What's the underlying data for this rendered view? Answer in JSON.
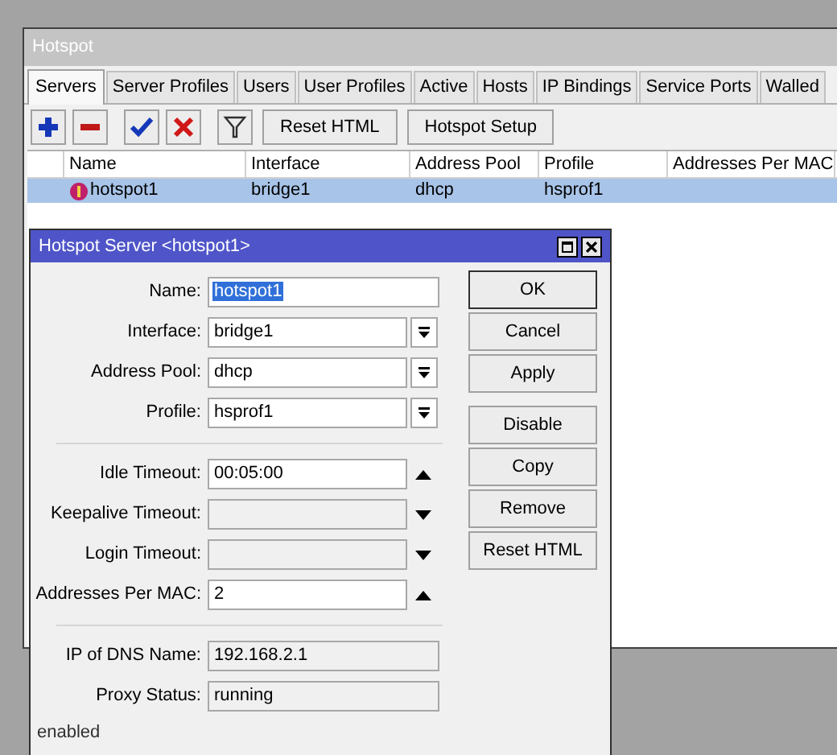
{
  "window": {
    "title": "Hotspot"
  },
  "tabs": [
    {
      "label": "Servers",
      "selected": true
    },
    {
      "label": "Server Profiles",
      "selected": false
    },
    {
      "label": "Users",
      "selected": false
    },
    {
      "label": "User Profiles",
      "selected": false
    },
    {
      "label": "Active",
      "selected": false
    },
    {
      "label": "Hosts",
      "selected": false
    },
    {
      "label": "IP Bindings",
      "selected": false
    },
    {
      "label": "Service Ports",
      "selected": false
    },
    {
      "label": "Walled",
      "selected": false
    }
  ],
  "toolbar": [
    {
      "kind": "add"
    },
    {
      "kind": "remove"
    },
    {
      "kind": "enable"
    },
    {
      "kind": "disable"
    },
    {
      "kind": "filter"
    },
    {
      "kind": "text",
      "label": "Reset HTML"
    },
    {
      "kind": "text",
      "label": "Hotspot Setup"
    }
  ],
  "table": {
    "columns": [
      "Name",
      "Interface",
      "Address Pool",
      "Profile",
      "Addresses Per MAC"
    ],
    "rows": [
      {
        "selected": true,
        "cells": [
          "hotspot1",
          "bridge1",
          "dhcp",
          "hsprof1"
        ]
      }
    ]
  },
  "dialog": {
    "title": "Hotspot Server <hotspot1>",
    "sections": [
      [
        {
          "kind": "text",
          "label": "Name:",
          "value": "hotspot1",
          "highlighted": true,
          "readonly": false
        },
        {
          "kind": "dropdown",
          "label": "Interface:",
          "value": "bridge1",
          "highlighted": false,
          "readonly": false
        },
        {
          "kind": "dropdown",
          "label": "Address Pool:",
          "value": "dhcp",
          "highlighted": false,
          "readonly": false
        },
        {
          "kind": "dropdown",
          "label": "Profile:",
          "value": "hsprof1",
          "highlighted": false,
          "readonly": false
        }
      ],
      [
        {
          "kind": "up",
          "label": "Idle Timeout:",
          "value": "00:05:00",
          "highlighted": false,
          "readonly": false
        },
        {
          "kind": "down",
          "label": "Keepalive Timeout:",
          "readonly": true
        },
        {
          "kind": "down",
          "label": "Login Timeout:",
          "readonly": true
        },
        {
          "kind": "up",
          "label": "Addresses Per MAC:",
          "value": "2",
          "highlighted": false,
          "readonly": false
        }
      ],
      [
        {
          "kind": "text",
          "label": "IP of DNS Name:",
          "value": "192.168.2.1",
          "highlighted": false,
          "readonly": true
        },
        {
          "kind": "text",
          "label": "Proxy Status:",
          "value": "running",
          "highlighted": false,
          "readonly": true
        }
      ]
    ],
    "buttons": [
      {
        "label": "OK",
        "default": true
      },
      {
        "label": "Cancel",
        "default": false
      },
      {
        "label": "Apply",
        "default": false
      },
      {
        "label": "Disable",
        "default": false
      },
      {
        "label": "Copy",
        "default": false
      },
      {
        "label": "Remove",
        "default": false
      },
      {
        "label": "Reset HTML",
        "default": false
      }
    ],
    "status": "enabled"
  }
}
